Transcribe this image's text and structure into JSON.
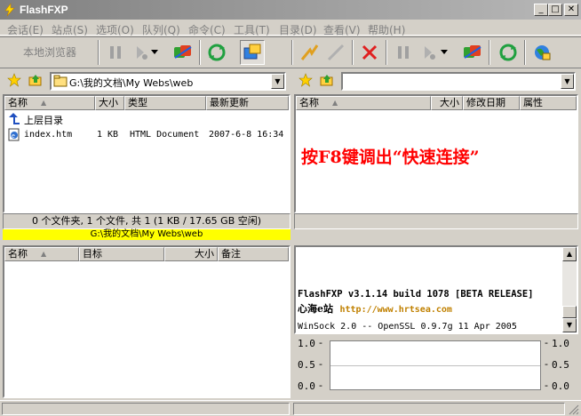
{
  "window": {
    "title": "FlashFXP"
  },
  "menu": [
    "会话(E)",
    "站点(S)",
    "选项(O)",
    "队列(Q)",
    "命令(C)",
    "工具(T)",
    "目录(D)",
    "查看(V)",
    "帮助(H)"
  ],
  "toolbar": {
    "local_browser": "本地浏览器"
  },
  "left": {
    "path": "G:\\我的文档\\My Webs\\web",
    "columns": [
      "名称",
      "大小",
      "类型",
      "最新更新"
    ],
    "rows": [
      {
        "name": "上层目录",
        "size": "",
        "type": "",
        "date": ""
      },
      {
        "name": "index.htm",
        "size": "1 KB",
        "type": "HTML Document",
        "date": "2007-6-8 16:34"
      }
    ],
    "status": "0 个文件夹, 1 个文件, 共 1 (1 KB / 17.65 GB 空闲)",
    "path_status": "G:\\我的文档\\My Webs\\web"
  },
  "right": {
    "path": "",
    "columns": [
      "名称",
      "大小",
      "修改日期",
      "属性"
    ],
    "annotation": "按F8键调出“快速连接”"
  },
  "queue": {
    "columns": [
      "名称",
      "目标",
      "大小",
      "备注"
    ]
  },
  "log": {
    "line1": "FlashFXP v3.1.14 build 1078 [BETA RELEASE]",
    "line2_site": "心海e站",
    "line2_url": "http://www.hrtsea.com",
    "line3": "WinSock 2.0 -- OpenSSL 0.9.7g 11 Apr 2005"
  },
  "graph": {
    "left_ticks": [
      "1.0",
      "0.5",
      "0.0"
    ],
    "right_ticks": [
      "1.0",
      "0.5",
      "0.0"
    ]
  },
  "colors": {
    "annotation": "#ff0000",
    "url": "#c08000",
    "path_bar": "#ffff00"
  }
}
